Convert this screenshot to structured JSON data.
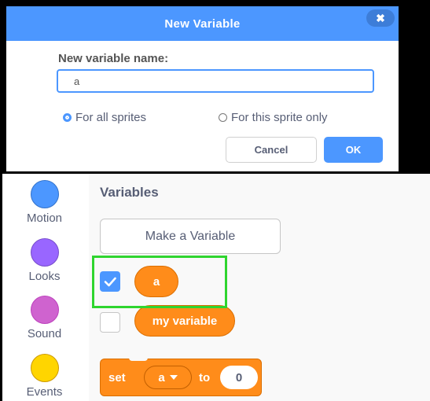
{
  "dialog": {
    "title": "New Variable",
    "close_icon": "close-icon",
    "field_label": "New variable name:",
    "input_value": "a",
    "scope_options": [
      {
        "label": "For all sprites",
        "selected": true
      },
      {
        "label": "For this sprite only",
        "selected": false
      }
    ],
    "cancel_label": "Cancel",
    "ok_label": "OK"
  },
  "sidebar": {
    "categories": [
      {
        "label": "Motion",
        "color": "#4c97ff"
      },
      {
        "label": "Looks",
        "color": "#9966ff"
      },
      {
        "label": "Sound",
        "color": "#cf63cf"
      },
      {
        "label": "Events",
        "color": "#ffbf00"
      }
    ]
  },
  "palette": {
    "title": "Variables",
    "make_variable_label": "Make a Variable",
    "variables": [
      {
        "name": "a",
        "checked": true
      },
      {
        "name": "my variable",
        "checked": false
      }
    ],
    "set_block": {
      "set_label": "set",
      "variable": "a",
      "to_label": "to",
      "value": "0"
    }
  },
  "colors": {
    "accent": "#4c97ff",
    "variables_orange": "#ff8c1a",
    "highlight_green": "#2fd52f"
  }
}
